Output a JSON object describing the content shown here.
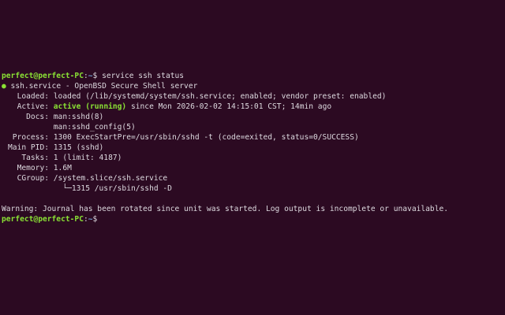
{
  "prompt": {
    "user_host": "perfect@perfect-PC",
    "colon": ":",
    "path": "~",
    "symbol": "$"
  },
  "command": " service ssh status",
  "status": {
    "bullet": "●",
    "unit_line": " ssh.service - OpenBSD Secure Shell server",
    "loaded_key": "Loaded:",
    "loaded_value": " loaded (/lib/systemd/system/ssh.service; enabled; vendor preset: enabled)",
    "active_key": "Active:",
    "active_state": "active (running)",
    "active_rest": " since Mon 2026-02-02 14:15:01 CST; 14min ago",
    "docs_key": "Docs:",
    "docs_value_1": " man:sshd(8)",
    "docs_value_2": " man:sshd_config(5)",
    "process_key": "Process:",
    "process_value": " 1300 ExecStartPre=/usr/sbin/sshd -t (code=exited, status=0/SUCCESS)",
    "mainpid_key": "Main PID:",
    "mainpid_value": " 1315 (sshd)",
    "tasks_key": "Tasks:",
    "tasks_value": " 1 (limit: 4187)",
    "memory_key": "Memory:",
    "memory_value": " 1.6M",
    "cgroup_key": "CGroup:",
    "cgroup_value": " /system.slice/ssh.service",
    "cgroup_child": "└─1315 /usr/sbin/sshd -D"
  },
  "warning": "Warning: Journal has been rotated since unit was started. Log output is incomplete or unavailable."
}
